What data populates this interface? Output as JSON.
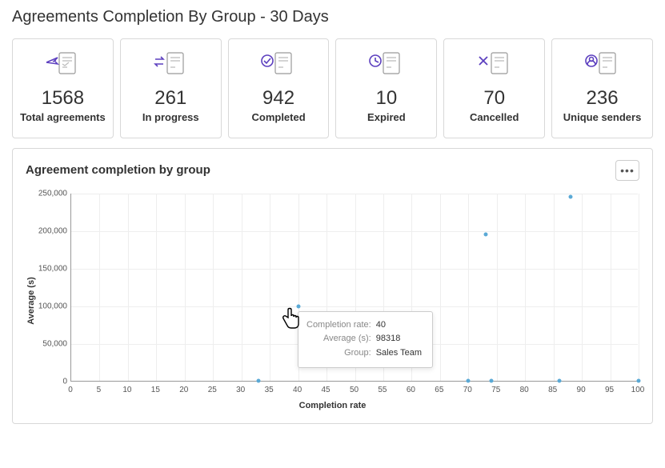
{
  "title": "Agreements Completion By Group - 30 Days",
  "stats": [
    {
      "value": "1568",
      "label": "Total agreements",
      "icon": "send"
    },
    {
      "value": "261",
      "label": "In progress",
      "icon": "progress"
    },
    {
      "value": "942",
      "label": "Completed",
      "icon": "completed"
    },
    {
      "value": "10",
      "label": "Expired",
      "icon": "expired"
    },
    {
      "value": "70",
      "label": "Cancelled",
      "icon": "cancelled"
    },
    {
      "value": "236",
      "label": "Unique senders",
      "icon": "senders"
    }
  ],
  "chart": {
    "title": "Agreement completion by group",
    "xlabel": "Completion rate",
    "ylabel": "Average (s)",
    "y_ticks": [
      "0",
      "50,000",
      "100,000",
      "150,000",
      "200,000",
      "250,000"
    ],
    "x_ticks": [
      "0",
      "5",
      "10",
      "15",
      "20",
      "25",
      "30",
      "35",
      "40",
      "45",
      "50",
      "55",
      "60",
      "65",
      "70",
      "75",
      "80",
      "85",
      "90",
      "95",
      "100"
    ]
  },
  "tooltip": {
    "completion_rate_label": "Completion rate:",
    "completion_rate_value": "40",
    "average_label": "Average (s):",
    "average_value": "98318",
    "group_label": "Group:",
    "group_value": "Sales Team"
  },
  "chart_data": {
    "type": "scatter",
    "title": "Agreement completion by group",
    "xlabel": "Completion rate",
    "ylabel": "Average (s)",
    "xlim": [
      0,
      100
    ],
    "ylim": [
      0,
      250000
    ],
    "series": [
      {
        "name": "Groups",
        "points": [
          {
            "x": 33,
            "y": 0
          },
          {
            "x": 40,
            "y": 98318,
            "group": "Sales Team"
          },
          {
            "x": 70,
            "y": 0
          },
          {
            "x": 73,
            "y": 195000
          },
          {
            "x": 74,
            "y": 0
          },
          {
            "x": 86,
            "y": 0
          },
          {
            "x": 88,
            "y": 245000
          },
          {
            "x": 100,
            "y": 0
          }
        ]
      }
    ]
  }
}
